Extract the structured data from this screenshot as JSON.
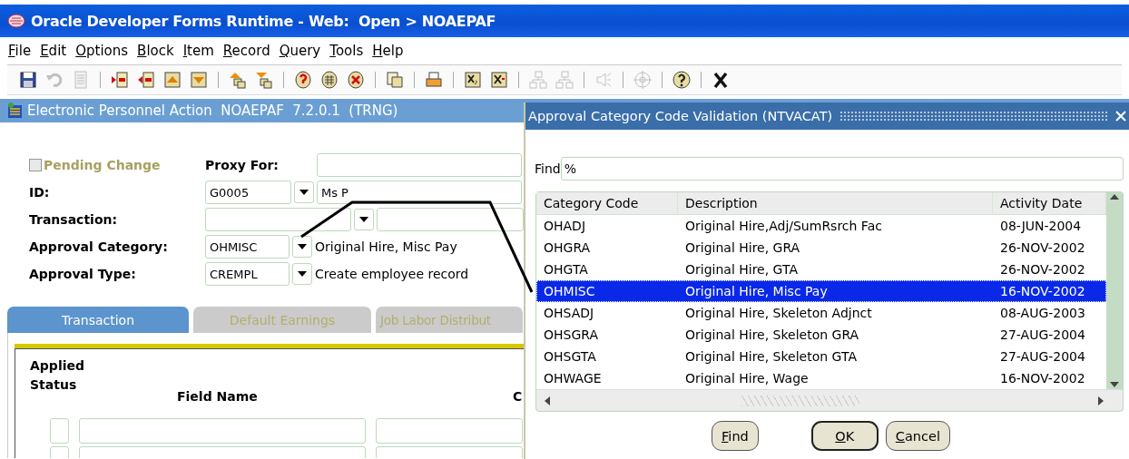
{
  "window": {
    "title": "Oracle Developer Forms Runtime - Web:  Open > NOAEPAF"
  },
  "menu": [
    "File",
    "Edit",
    "Options",
    "Block",
    "Item",
    "Record",
    "Query",
    "Tools",
    "Help"
  ],
  "toolbar": [
    [
      {
        "kind": "save",
        "disabled": false
      },
      {
        "kind": "undo",
        "disabled": true
      },
      {
        "kind": "document",
        "disabled": true
      }
    ],
    [
      {
        "kind": "insert",
        "disabled": false
      },
      {
        "kind": "remove",
        "disabled": false
      },
      {
        "kind": "up",
        "disabled": false
      },
      {
        "kind": "down",
        "disabled": false
      }
    ],
    [
      {
        "kind": "enter-query",
        "disabled": false
      },
      {
        "kind": "execute-query",
        "disabled": false
      }
    ],
    [
      {
        "kind": "db-help",
        "disabled": false
      },
      {
        "kind": "db-table",
        "disabled": false
      },
      {
        "kind": "db-delete",
        "disabled": false
      }
    ],
    [
      {
        "kind": "copy",
        "disabled": false
      }
    ],
    [
      {
        "kind": "print",
        "disabled": false
      }
    ],
    [
      {
        "kind": "xs",
        "disabled": false
      },
      {
        "kind": "x-doc",
        "disabled": false
      }
    ],
    [
      {
        "kind": "tree",
        "disabled": true
      },
      {
        "kind": "tree",
        "disabled": true
      }
    ],
    [
      {
        "kind": "speaker",
        "disabled": true
      }
    ],
    [
      {
        "kind": "target",
        "disabled": true
      }
    ],
    [
      {
        "kind": "help",
        "disabled": false
      }
    ],
    [
      {
        "kind": "exit",
        "disabled": false
      }
    ]
  ],
  "form": {
    "title": "Electronic Personnel Action  NOAEPAF  7.2.0.1  (TRNG)",
    "pending_change": {
      "label": "Pending Change",
      "checked": false,
      "disabled": true
    },
    "proxy_for": {
      "label": "Proxy For:"
    },
    "fields": [
      {
        "kind": "boxed",
        "label": "ID:",
        "code": "G0005",
        "description": "Ms P"
      },
      {
        "kind": "wide",
        "label": "Transaction:"
      },
      {
        "kind": "plain",
        "label": "Approval Category:",
        "code": "OHMISC",
        "description": "Original Hire, Misc Pay"
      },
      {
        "kind": "plain",
        "label": "Approval Type:",
        "code": "CREMPL",
        "description": "Create employee record"
      }
    ],
    "tabs": [
      {
        "label": "Transaction",
        "selected": true
      },
      {
        "label": "Default Earnings",
        "selected": false
      },
      {
        "label": "Job Labor Distribut",
        "selected": false
      }
    ],
    "columns": [
      "Applied Status",
      "Field Name",
      "C"
    ]
  },
  "dialog": {
    "title": "Approval Category Code Validation (NTVACAT)",
    "find": {
      "label": "Find",
      "value": "%"
    },
    "columns": [
      "Category Code",
      "Description",
      "Activity Date"
    ],
    "rows": [
      {
        "code": "OHADJ",
        "description": "Original Hire,Adj/SumRsrch Fac",
        "date": "08-JUN-2004",
        "selected": false
      },
      {
        "code": "OHGRA",
        "description": "Original Hire, GRA",
        "date": "26-NOV-2002",
        "selected": false
      },
      {
        "code": "OHGTA",
        "description": "Original Hire, GTA",
        "date": "26-NOV-2002",
        "selected": false
      },
      {
        "code": "OHMISC",
        "description": "Original Hire, Misc Pay",
        "date": "16-NOV-2002",
        "selected": true
      },
      {
        "code": "OHSADJ",
        "description": "Original Hire, Skeleton Adjnct",
        "date": "08-AUG-2003",
        "selected": false
      },
      {
        "code": "OHSGRA",
        "description": "Original Hire, Skeleton GRA",
        "date": "27-AUG-2004",
        "selected": false
      },
      {
        "code": "OHSGTA",
        "description": "Original Hire, Skeleton GTA",
        "date": "27-AUG-2004",
        "selected": false
      },
      {
        "code": "OHWAGE",
        "description": "Original Hire, Wage",
        "date": "16-NOV-2002",
        "selected": false
      }
    ],
    "buttons": [
      {
        "label": "Find",
        "default": false
      },
      {
        "label": "OK",
        "default": true
      },
      {
        "label": "Cancel",
        "default": false
      }
    ]
  }
}
